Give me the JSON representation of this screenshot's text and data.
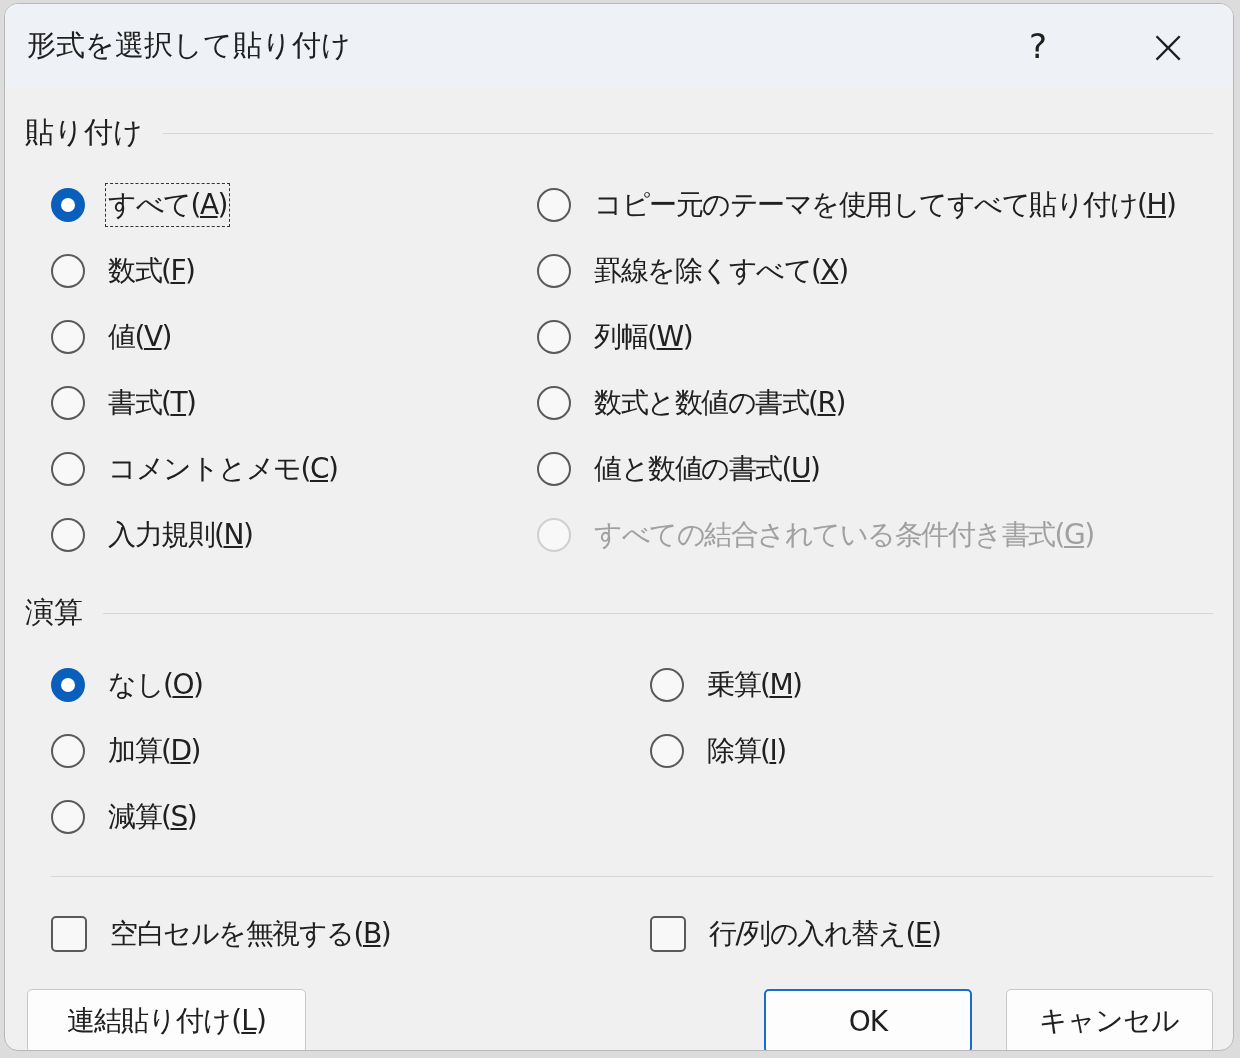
{
  "window": {
    "title": "形式を選択して貼り付け",
    "help": "?",
    "close": "×"
  },
  "paste": {
    "label": "貼り付け",
    "options": [
      {
        "pre": "すべて(",
        "key": "A",
        "post": ")",
        "selected": true,
        "disabled": false,
        "focused": true
      },
      {
        "pre": "コピー元のテーマを使用してすべて貼り付け(",
        "key": "H",
        "post": ")",
        "selected": false,
        "disabled": false,
        "focused": false
      },
      {
        "pre": "数式(",
        "key": "F",
        "post": ")",
        "selected": false,
        "disabled": false,
        "focused": false
      },
      {
        "pre": "罫線を除くすべて(",
        "key": "X",
        "post": ")",
        "selected": false,
        "disabled": false,
        "focused": false
      },
      {
        "pre": "値(",
        "key": "V",
        "post": ")",
        "selected": false,
        "disabled": false,
        "focused": false
      },
      {
        "pre": "列幅(",
        "key": "W",
        "post": ")",
        "selected": false,
        "disabled": false,
        "focused": false
      },
      {
        "pre": "書式(",
        "key": "T",
        "post": ")",
        "selected": false,
        "disabled": false,
        "focused": false
      },
      {
        "pre": "数式と数値の書式(",
        "key": "R",
        "post": ")",
        "selected": false,
        "disabled": false,
        "focused": false
      },
      {
        "pre": "コメントとメモ(",
        "key": "C",
        "post": ")",
        "selected": false,
        "disabled": false,
        "focused": false
      },
      {
        "pre": "値と数値の書式(",
        "key": "U",
        "post": ")",
        "selected": false,
        "disabled": false,
        "focused": false
      },
      {
        "pre": "入力規則(",
        "key": "N",
        "post": ")",
        "selected": false,
        "disabled": false,
        "focused": false
      },
      {
        "pre": "すべての結合されている条件付き書式(",
        "key": "G",
        "post": ")",
        "selected": false,
        "disabled": true,
        "focused": false
      }
    ]
  },
  "operation": {
    "label": "演算",
    "options": [
      {
        "pre": "なし(",
        "key": "O",
        "post": ")",
        "selected": true,
        "disabled": false,
        "focused": false
      },
      {
        "pre": "乗算(",
        "key": "M",
        "post": ")",
        "selected": false,
        "disabled": false,
        "focused": false
      },
      {
        "pre": "加算(",
        "key": "D",
        "post": ")",
        "selected": false,
        "disabled": false,
        "focused": false
      },
      {
        "pre": "除算(",
        "key": "I",
        "post": ")",
        "selected": false,
        "disabled": false,
        "focused": false
      },
      {
        "pre": "減算(",
        "key": "S",
        "post": ")",
        "selected": false,
        "disabled": false,
        "focused": false
      }
    ]
  },
  "checkboxes": [
    {
      "pre": "空白セルを無視する(",
      "key": "B",
      "post": ")",
      "checked": false
    },
    {
      "pre": "行/列の入れ替え(",
      "key": "E",
      "post": ")",
      "checked": false
    }
  ],
  "buttons": [
    {
      "pre": "連結貼り付け(",
      "key": "L",
      "post": ")",
      "default": false
    },
    {
      "pre": "OK",
      "default": true
    },
    {
      "pre": "キャンセル",
      "default": false
    }
  ]
}
